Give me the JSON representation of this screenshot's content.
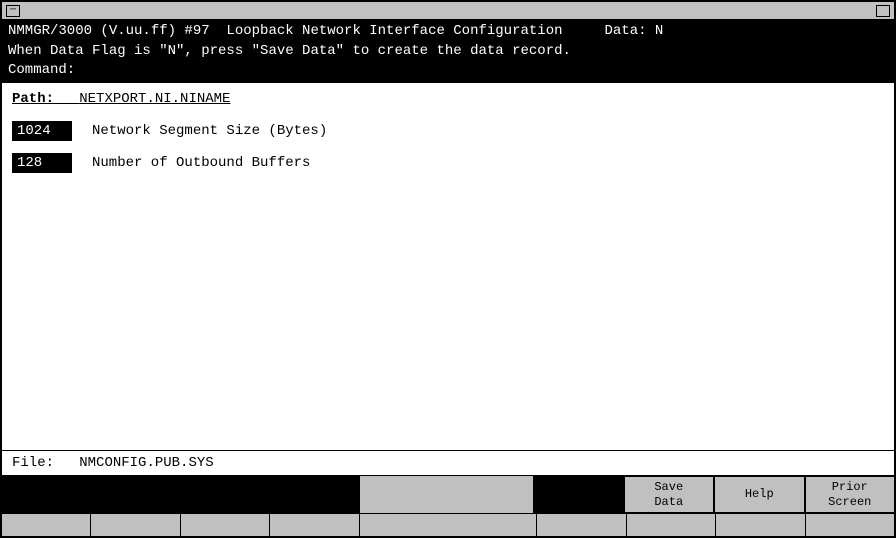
{
  "window": {
    "title": ""
  },
  "header": {
    "line1": "NMMGR/3000 (V.uu.ff) #97  Loopback Network Interface Configuration     Data: N",
    "line2": "When Data Flag is \"N\", press \"Save Data\" to create the data record.",
    "line3": "Command:"
  },
  "path": {
    "label": "Path:",
    "value": "NETXPORT.NI.NINAME"
  },
  "fields": [
    {
      "input_value": "1024 ",
      "label": "Network Segment Size (Bytes)"
    },
    {
      "input_value": "128  ",
      "label": "Number of Outbound Buffers"
    }
  ],
  "footer": {
    "file_label": "File:",
    "file_value": "NMCONFIG.PUB.SYS"
  },
  "buttons": {
    "top": [
      {
        "label": "",
        "type": "empty"
      },
      {
        "label": "",
        "type": "empty"
      },
      {
        "label": "",
        "type": "empty"
      },
      {
        "label": "",
        "type": "empty"
      },
      {
        "label": "",
        "type": "spacer"
      },
      {
        "label": "",
        "type": "empty"
      },
      {
        "label": "Save\nData",
        "type": "active"
      },
      {
        "label": "Help",
        "type": "active"
      },
      {
        "label": "Prior\nScreen",
        "type": "active"
      }
    ]
  }
}
